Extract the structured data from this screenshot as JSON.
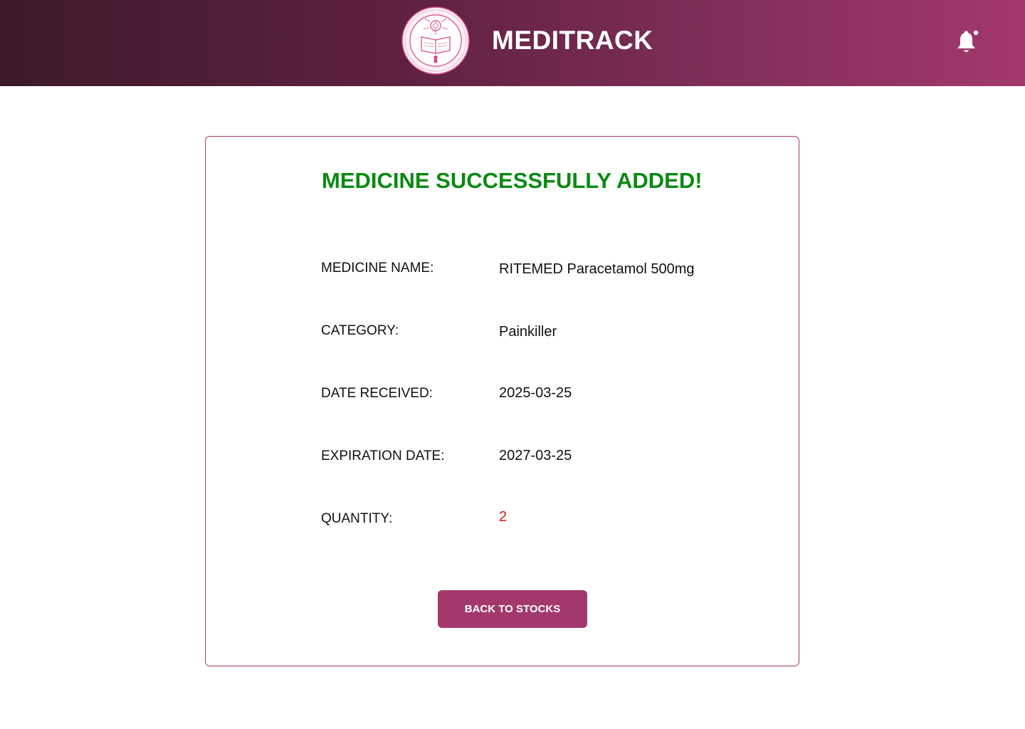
{
  "header": {
    "app_title": "MEDITRACK",
    "logo": {
      "icon": "university-seal-logo",
      "text": "UNIVERSITY OF THE IMMACULATE CONCEPTION · DAVAO CITY · 1905"
    },
    "notification_icon": "bell-icon",
    "gradient_colors": [
      "#3e1a2b",
      "#a3386c"
    ]
  },
  "card": {
    "title": "MEDICINE SUCCESSFULLY ADDED!",
    "title_color": "#0a8a12",
    "fields": [
      {
        "label": "MEDICINE NAME:",
        "value": "RITEMED Paracetamol 500mg"
      },
      {
        "label": "CATEGORY:",
        "value": "Painkiller"
      },
      {
        "label": "DATE RECEIVED:",
        "value": "2025-03-25"
      },
      {
        "label": "EXPIRATION DATE:",
        "value": "2027-03-25"
      },
      {
        "label": "QUANTITY:",
        "value": "2"
      }
    ],
    "quantity_color": "#e30c0c",
    "back_button_label": "BACK TO STOCKS",
    "accent_color": "#a3386c"
  }
}
